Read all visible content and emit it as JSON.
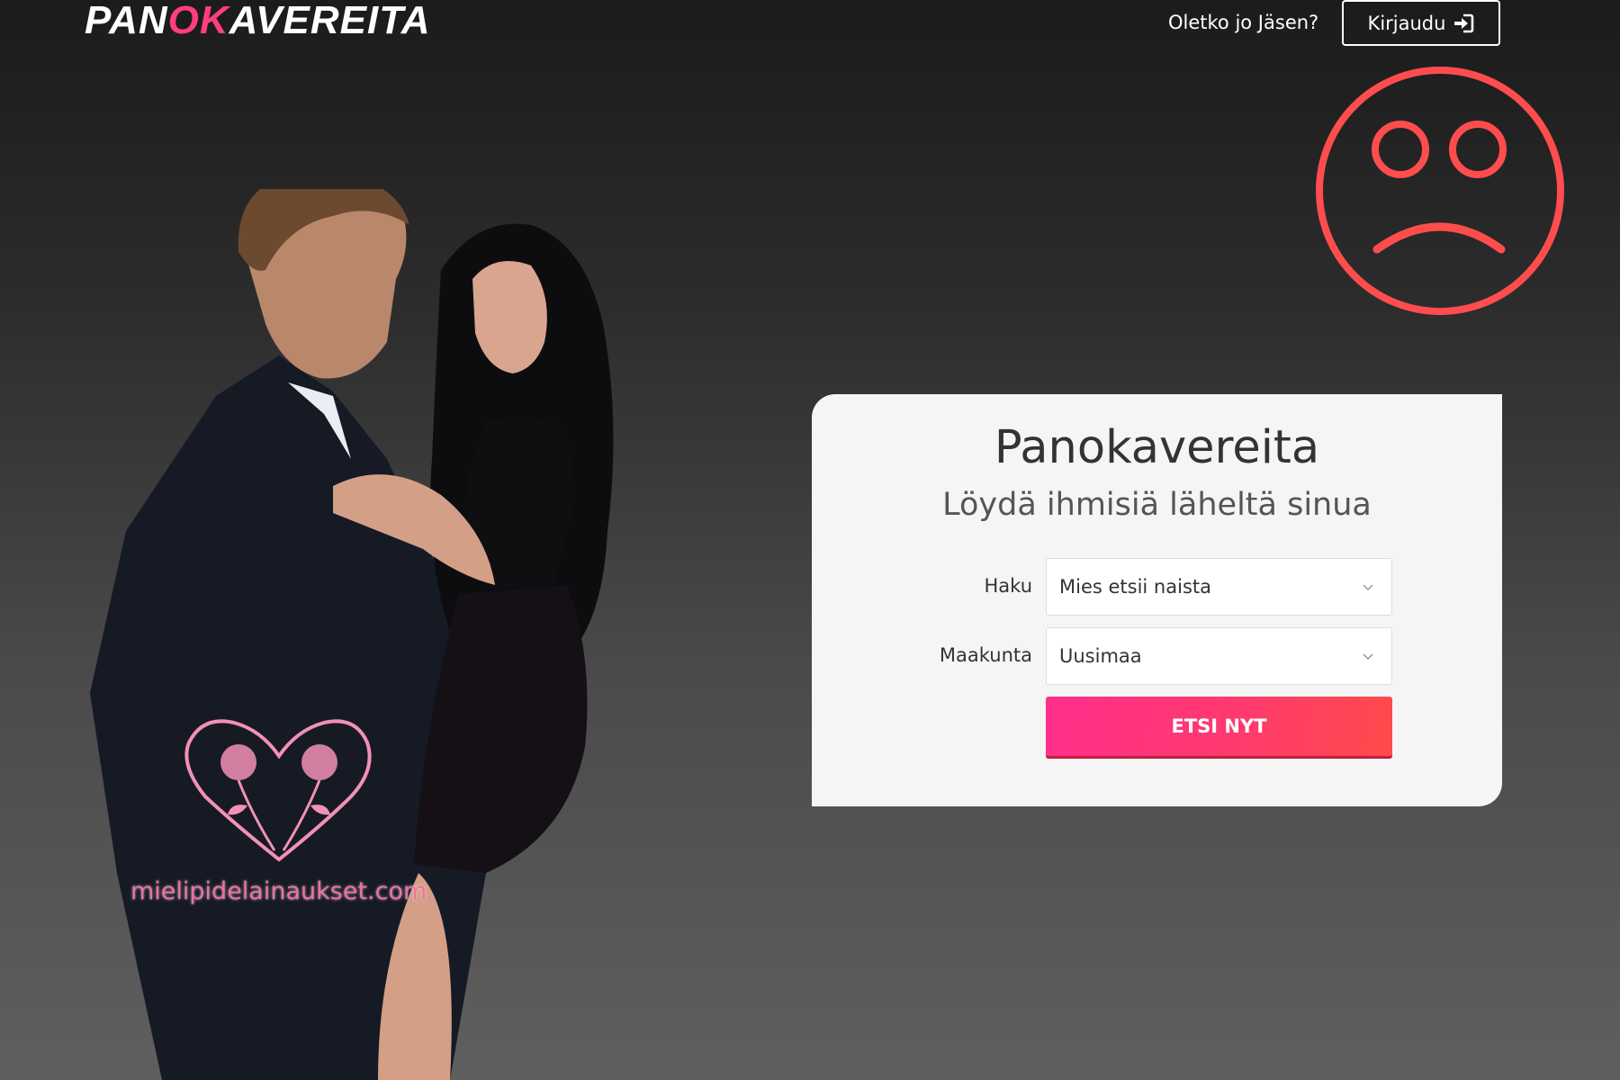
{
  "header": {
    "logo_part1": "PAN",
    "logo_part2": "OK",
    "logo_part3": "AVEREITA",
    "member_question": "Oletko jo Jäsen?",
    "login_label": "Kirjaudu"
  },
  "search_card": {
    "title": "Panokavereita",
    "subtitle": "Löydä ihmisiä läheltä sinua",
    "search_label": "Haku",
    "search_value": "Mies etsii naista",
    "region_label": "Maakunta",
    "region_value": "Uusimaa",
    "submit_label": "ETSI NYT"
  },
  "watermark": {
    "text": "mielipidelainaukset.com"
  },
  "icons": {
    "login": "sign-in-icon",
    "sad_face": "sad-face-icon",
    "dropdown": "chevron-down-icon",
    "watermark": "heart-roses-logo"
  },
  "colors": {
    "brand_pink": "#ff3d7f",
    "button_gradient_start": "#ff2f8b",
    "button_gradient_end": "#ff4a4a",
    "sad_face_red": "#ff4d4d"
  }
}
